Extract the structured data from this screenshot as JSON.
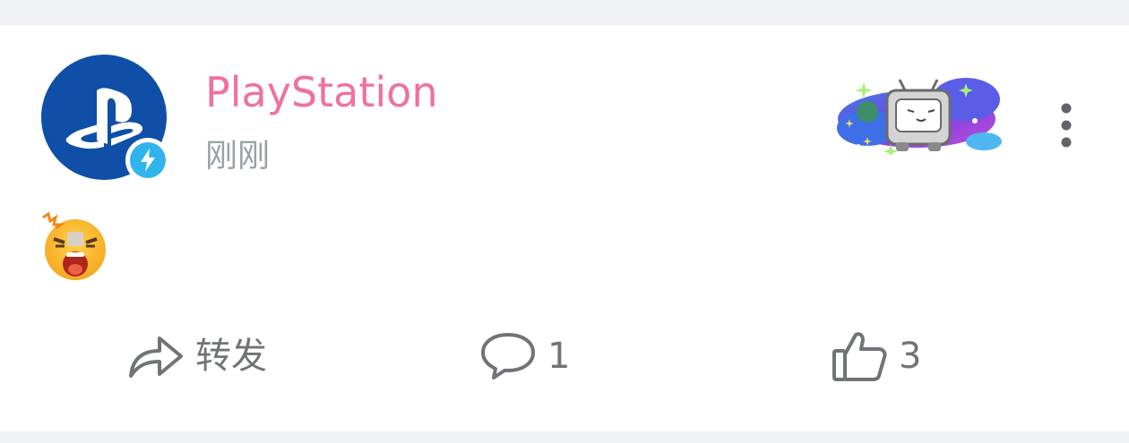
{
  "post": {
    "author": "PlayStation",
    "time": "刚刚",
    "author_color": "#f0709e",
    "avatar_bg": "#0f4fa8",
    "badge_color": "#2fb4ec",
    "content_emoji": "shocked-face-emoji"
  },
  "actions": {
    "forward_label": "转发",
    "comment_count": "1",
    "like_count": "3"
  },
  "icons": {
    "more": "more-vertical-icon",
    "forward": "share-arrow-icon",
    "comment": "speech-bubble-icon",
    "like": "thumbs-up-icon",
    "badge": "lightning-icon"
  }
}
